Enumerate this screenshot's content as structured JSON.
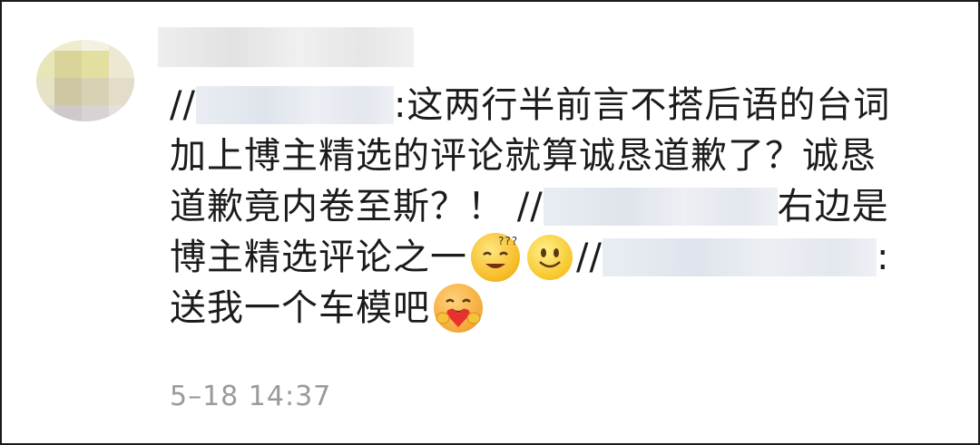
{
  "comment": {
    "line1_prefix": "//",
    "line1_text": ":这两行半前言不搭后语的台词",
    "line2_text": "加上博主精选的评论就算诚恳道歉了？诚恳",
    "line3_text": "道歉竟内卷至斯？！ //",
    "line3_suffix": "右边是",
    "line4_text": "博主精选评论之一",
    "line4_prefix2": "//",
    "line4_suffix": ":",
    "line5_text": "送我一个车模吧"
  },
  "emojis": [
    "dizzy-face-emoji",
    "smile-emoji",
    "hug-emoji"
  ],
  "meta": {
    "timestamp": "5–18 14:37"
  },
  "colors": {
    "text": "#1b1b1b",
    "timestamp": "#9a9a9a",
    "blur": "#e3e7ee"
  }
}
